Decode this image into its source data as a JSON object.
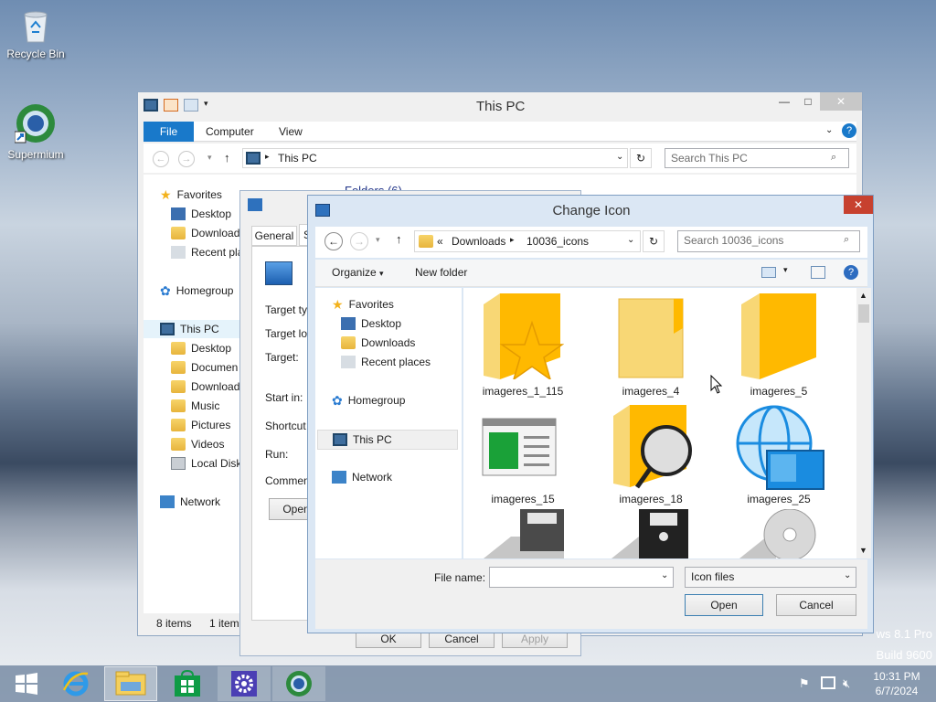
{
  "desktop": {
    "icons": [
      {
        "label": "Recycle Bin",
        "icon": "recycle-bin-icon"
      },
      {
        "label": "Supermium",
        "icon": "supermium-icon"
      }
    ],
    "watermark": [
      "ws 8.1 Pro",
      "Build 9600"
    ]
  },
  "explorer": {
    "title": "This PC",
    "ribbon_tabs": [
      "File",
      "Computer",
      "View"
    ],
    "address": "This PC",
    "search_placeholder": "Search This PC",
    "nav": {
      "favorites_header": "Favorites",
      "favorites": [
        "Desktop",
        "Download",
        "Recent pla"
      ],
      "homegroup": "Homegroup",
      "thispc": "This PC",
      "thispc_items": [
        "Desktop",
        "Documen",
        "Download",
        "Music",
        "Pictures",
        "Videos",
        "Local Disk"
      ],
      "network": "Network"
    },
    "status_items": "8 items",
    "status_item2": "1 item",
    "partial_header": "Folders (6)"
  },
  "properties": {
    "tabs": [
      "General",
      "S"
    ],
    "fields": [
      "Target ty",
      "Target lo",
      "Target:",
      "Start in:",
      "Shortcut",
      "Run:",
      "Commen"
    ],
    "open_button": "Open",
    "ok_label": "OK",
    "cancel_label": "Cancel",
    "apply_label": "Apply"
  },
  "dialog": {
    "title": "Change Icon",
    "close_glyph": "✕",
    "breadcrumb": [
      "Downloads",
      "10036_icons"
    ],
    "breadcrumb_prefix": "«",
    "search_placeholder": "Search 10036_icons",
    "organize_label": "Organize",
    "new_folder_label": "New folder",
    "nav": {
      "favorites_header": "Favorites",
      "favorites": [
        "Desktop",
        "Downloads",
        "Recent places"
      ],
      "homegroup": "Homegroup",
      "thispc": "This PC",
      "network": "Network"
    },
    "files": [
      {
        "name": "imageres_1_115",
        "icon": "folder-star-icon"
      },
      {
        "name": "imageres_4",
        "icon": "folder-icon"
      },
      {
        "name": "imageres_5",
        "icon": "folder-open-icon"
      },
      {
        "name": "imageres_15",
        "icon": "window-app-icon"
      },
      {
        "name": "imageres_18",
        "icon": "folder-search-icon"
      },
      {
        "name": "imageres_25",
        "icon": "globe-network-icon"
      }
    ],
    "file_name_label": "File name:",
    "file_name_value": "",
    "file_type_value": "Icon files",
    "open_label": "Open",
    "cancel_label": "Cancel"
  },
  "taskbar": {
    "items": [
      "start-icon",
      "internet-explorer-icon",
      "file-explorer-icon",
      "store-icon",
      "settings-icon",
      "supermium-icon"
    ],
    "time": "10:31 PM",
    "date": "6/7/2024"
  },
  "colors": {
    "accent": "#1979ca",
    "dialog_border": "#7f9ec2",
    "close_red": "#c7412f",
    "selection": "#e5f3fb"
  }
}
